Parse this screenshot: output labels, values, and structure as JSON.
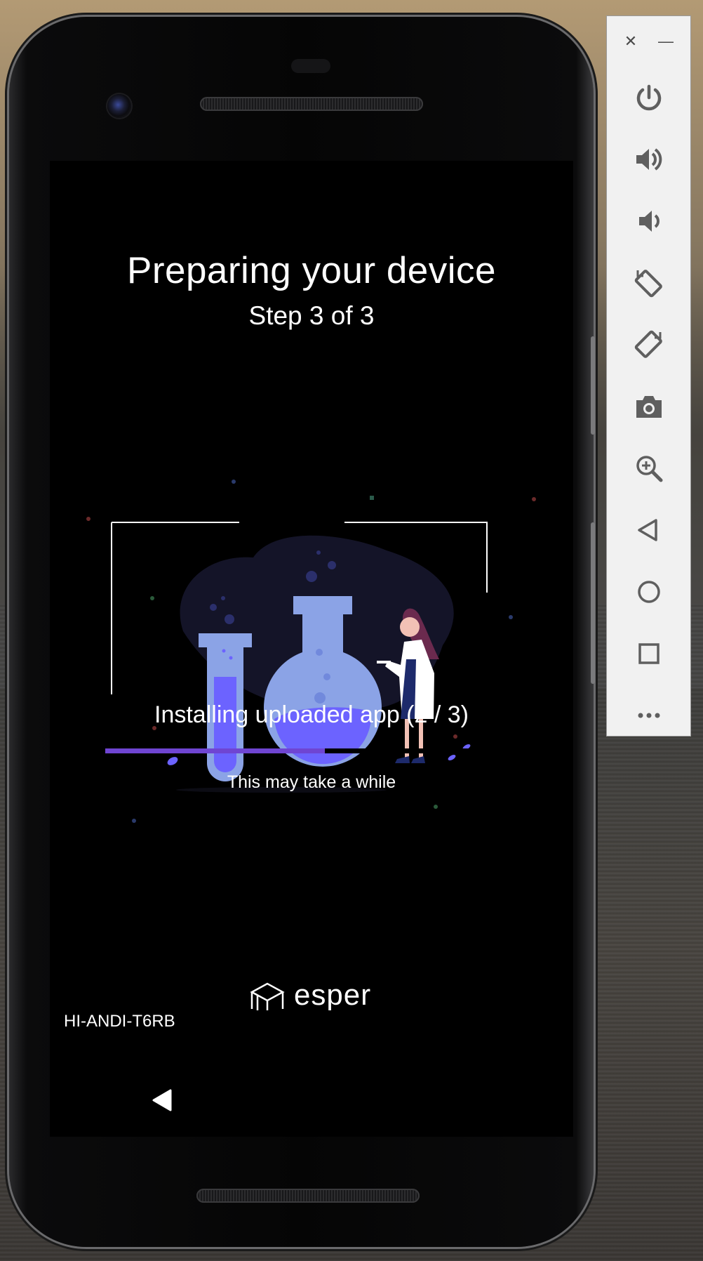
{
  "screen": {
    "title": "Preparing your device",
    "step": "Step 3 of 3",
    "status": "Installing uploaded app (2 / 3)",
    "progress_fraction": 0.533,
    "progress_color": "#6f45d2",
    "hint": "This may take a while",
    "brand": "esper",
    "device_id": "HI-ANDI-T6RB"
  },
  "toolbar": {
    "close_symbol": "✕",
    "minimize_symbol": "—",
    "buttons": [
      {
        "icon": "power-icon"
      },
      {
        "icon": "volume-up-icon"
      },
      {
        "icon": "volume-down-icon"
      },
      {
        "icon": "rotate-left-icon"
      },
      {
        "icon": "rotate-right-icon"
      },
      {
        "icon": "camera-icon"
      },
      {
        "icon": "zoom-icon"
      },
      {
        "icon": "back-icon"
      },
      {
        "icon": "home-icon"
      },
      {
        "icon": "overview-icon"
      },
      {
        "icon": "more-icon"
      }
    ]
  },
  "colors": {
    "screen_bg": "#000000",
    "toolbar_bg": "#f1f1f1",
    "icon_gray": "#5f5f5f",
    "flask_blue": "#8ba3e6",
    "liquid_purple": "#6c63ff"
  }
}
